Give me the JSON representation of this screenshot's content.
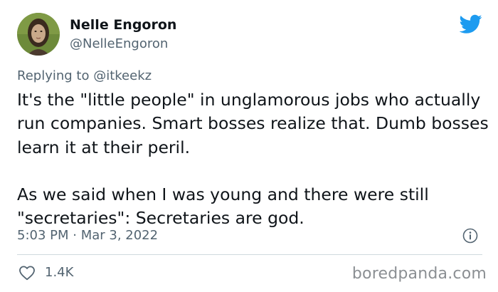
{
  "author": {
    "display_name": "Nelle Engoron",
    "handle": "@NelleEngoron"
  },
  "reply": {
    "prefix": "Replying to ",
    "mention": "@itkeekz"
  },
  "tweet": {
    "paragraphs": [
      "It's the \"little people\" in unglamorous jobs who actually run companies. Smart bosses realize that. Dumb bosses learn it at their peril.",
      "As we said when I was young and there were still \"secretaries\": Secretaries are god."
    ],
    "timestamp": "5:03 PM · Mar 3, 2022"
  },
  "actions": {
    "like_count": "1.4K"
  },
  "watermark": "boredpanda.com",
  "icons": {
    "brand": "twitter-bird-icon",
    "info": "info-icon",
    "like": "heart-icon"
  },
  "colors": {
    "brand_blue": "#1d9bf0",
    "text_primary": "#0f1419",
    "text_secondary": "#536471",
    "divider": "#cfd9de",
    "watermark": "#8b8f93"
  }
}
